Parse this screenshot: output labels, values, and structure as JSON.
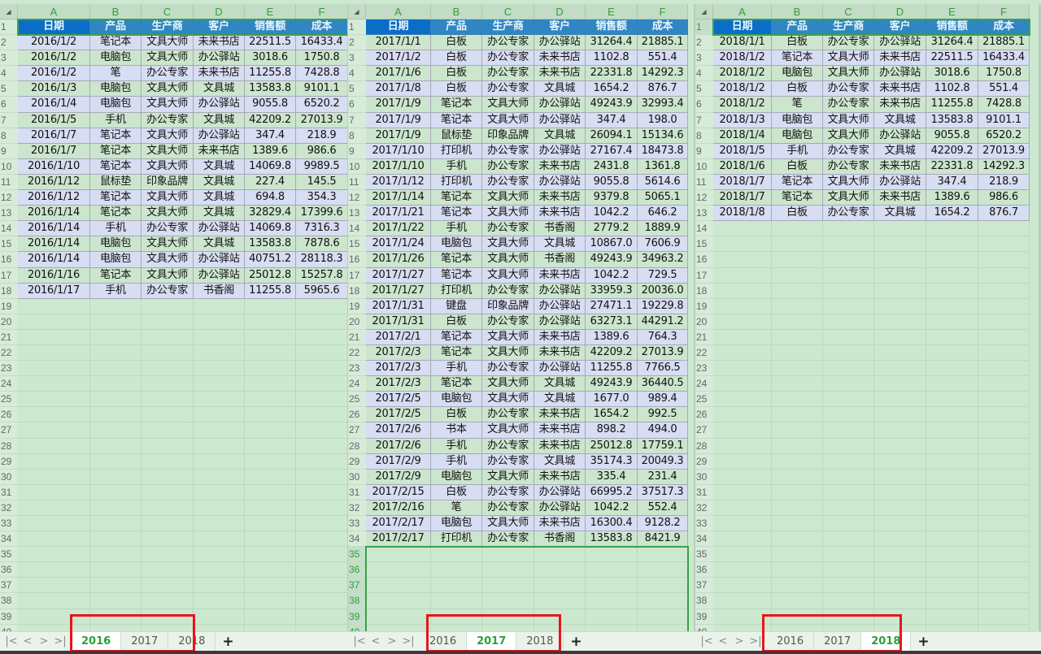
{
  "columns": [
    "A",
    "B",
    "C",
    "D",
    "E",
    "F"
  ],
  "header_row": [
    "日期",
    "产品",
    "生产商",
    "客户",
    "销售额",
    "成本"
  ],
  "tab_nav": {
    "first": "|<",
    "prev": "<",
    "next": ">",
    "last": ">|"
  },
  "add_sheet_label": "+",
  "highlight_color": "#e5161d",
  "accent_color": "#2e9e3e",
  "header_fill": "#2f86c2",
  "panes": [
    {
      "id": "2016",
      "active_tab": "2016",
      "tabs": [
        "2016",
        "2017",
        "2018"
      ],
      "visible_row_count": 40,
      "rows": [
        [
          "2016/1/2",
          "笔记本",
          "文具大师",
          "未来书店",
          "22511.5",
          "16433.4"
        ],
        [
          "2016/1/2",
          "电脑包",
          "文具大师",
          "办公驿站",
          "3018.6",
          "1750.8"
        ],
        [
          "2016/1/2",
          "笔",
          "办公专家",
          "未来书店",
          "11255.8",
          "7428.8"
        ],
        [
          "2016/1/3",
          "电脑包",
          "文具大师",
          "文具城",
          "13583.8",
          "9101.1"
        ],
        [
          "2016/1/4",
          "电脑包",
          "文具大师",
          "办公驿站",
          "9055.8",
          "6520.2"
        ],
        [
          "2016/1/5",
          "手机",
          "办公专家",
          "文具城",
          "42209.2",
          "27013.9"
        ],
        [
          "2016/1/7",
          "笔记本",
          "文具大师",
          "办公驿站",
          "347.4",
          "218.9"
        ],
        [
          "2016/1/7",
          "笔记本",
          "文具大师",
          "未来书店",
          "1389.6",
          "986.6"
        ],
        [
          "2016/1/10",
          "笔记本",
          "文具大师",
          "文具城",
          "14069.8",
          "9989.5"
        ],
        [
          "2016/1/12",
          "鼠标垫",
          "印象品牌",
          "文具城",
          "227.4",
          "145.5"
        ],
        [
          "2016/1/12",
          "笔记本",
          "文具大师",
          "文具城",
          "694.8",
          "354.3"
        ],
        [
          "2016/1/14",
          "笔记本",
          "文具大师",
          "文具城",
          "32829.4",
          "17399.6"
        ],
        [
          "2016/1/14",
          "手机",
          "办公专家",
          "办公驿站",
          "14069.8",
          "7316.3"
        ],
        [
          "2016/1/14",
          "电脑包",
          "文具大师",
          "文具城",
          "13583.8",
          "7878.6"
        ],
        [
          "2016/1/14",
          "电脑包",
          "文具大师",
          "办公驿站",
          "40751.2",
          "28118.3"
        ],
        [
          "2016/1/16",
          "笔记本",
          "文具大师",
          "办公驿站",
          "25012.8",
          "15257.8"
        ],
        [
          "2016/1/17",
          "手机",
          "办公专家",
          "书香阁",
          "11255.8",
          "5965.6"
        ]
      ]
    },
    {
      "id": "2017",
      "active_tab": "2017",
      "tabs": [
        "2016",
        "2017",
        "2018"
      ],
      "visible_row_count": 40,
      "rows": [
        [
          "2017/1/1",
          "白板",
          "办公专家",
          "办公驿站",
          "31264.4",
          "21885.1"
        ],
        [
          "2017/1/2",
          "白板",
          "办公专家",
          "未来书店",
          "1102.8",
          "551.4"
        ],
        [
          "2017/1/6",
          "白板",
          "办公专家",
          "未来书店",
          "22331.8",
          "14292.3"
        ],
        [
          "2017/1/8",
          "白板",
          "办公专家",
          "文具城",
          "1654.2",
          "876.7"
        ],
        [
          "2017/1/9",
          "笔记本",
          "文具大师",
          "办公驿站",
          "49243.9",
          "32993.4"
        ],
        [
          "2017/1/9",
          "笔记本",
          "文具大师",
          "办公驿站",
          "347.4",
          "198.0"
        ],
        [
          "2017/1/9",
          "鼠标垫",
          "印象品牌",
          "文具城",
          "26094.1",
          "15134.6"
        ],
        [
          "2017/1/10",
          "打印机",
          "办公专家",
          "办公驿站",
          "27167.4",
          "18473.8"
        ],
        [
          "2017/1/10",
          "手机",
          "办公专家",
          "未来书店",
          "2431.8",
          "1361.8"
        ],
        [
          "2017/1/12",
          "打印机",
          "办公专家",
          "办公驿站",
          "9055.8",
          "5614.6"
        ],
        [
          "2017/1/14",
          "笔记本",
          "文具大师",
          "未来书店",
          "9379.8",
          "5065.1"
        ],
        [
          "2017/1/21",
          "笔记本",
          "文具大师",
          "未来书店",
          "1042.2",
          "646.2"
        ],
        [
          "2017/1/22",
          "手机",
          "办公专家",
          "书香阁",
          "2779.2",
          "1889.9"
        ],
        [
          "2017/1/24",
          "电脑包",
          "文具大师",
          "文具城",
          "10867.0",
          "7606.9"
        ],
        [
          "2017/1/26",
          "笔记本",
          "文具大师",
          "书香阁",
          "49243.9",
          "34963.2"
        ],
        [
          "2017/1/27",
          "笔记本",
          "文具大师",
          "未来书店",
          "1042.2",
          "729.5"
        ],
        [
          "2017/1/27",
          "打印机",
          "办公专家",
          "办公驿站",
          "33959.3",
          "20036.0"
        ],
        [
          "2017/1/31",
          "键盘",
          "印象品牌",
          "办公驿站",
          "27471.1",
          "19229.8"
        ],
        [
          "2017/1/31",
          "白板",
          "办公专家",
          "办公驿站",
          "63273.1",
          "44291.2"
        ],
        [
          "2017/2/1",
          "笔记本",
          "文具大师",
          "未来书店",
          "1389.6",
          "764.3"
        ],
        [
          "2017/2/3",
          "笔记本",
          "文具大师",
          "未来书店",
          "42209.2",
          "27013.9"
        ],
        [
          "2017/2/3",
          "手机",
          "办公专家",
          "办公驿站",
          "11255.8",
          "7766.5"
        ],
        [
          "2017/2/3",
          "笔记本",
          "文具大师",
          "文具城",
          "49243.9",
          "36440.5"
        ],
        [
          "2017/2/5",
          "电脑包",
          "文具大师",
          "文具城",
          "1677.0",
          "989.4"
        ],
        [
          "2017/2/5",
          "白板",
          "办公专家",
          "未来书店",
          "1654.2",
          "992.5"
        ],
        [
          "2017/2/6",
          "书本",
          "文具大师",
          "未来书店",
          "898.2",
          "494.0"
        ],
        [
          "2017/2/6",
          "手机",
          "办公专家",
          "未来书店",
          "25012.8",
          "17759.1"
        ],
        [
          "2017/2/9",
          "手机",
          "办公专家",
          "文具城",
          "35174.3",
          "20049.3"
        ],
        [
          "2017/2/9",
          "电脑包",
          "文具大师",
          "未来书店",
          "335.4",
          "231.4"
        ],
        [
          "2017/2/15",
          "白板",
          "办公专家",
          "办公驿站",
          "66995.2",
          "37517.3"
        ],
        [
          "2017/2/16",
          "笔",
          "办公专家",
          "办公驿站",
          "1042.2",
          "552.4"
        ],
        [
          "2017/2/17",
          "电脑包",
          "文具大师",
          "未来书店",
          "16300.4",
          "9128.2"
        ],
        [
          "2017/2/17",
          "打印机",
          "办公专家",
          "书香阁",
          "13583.8",
          "8421.9"
        ]
      ]
    },
    {
      "id": "2018",
      "active_tab": "2018",
      "tabs": [
        "2016",
        "2017",
        "2018"
      ],
      "visible_row_count": 40,
      "rows": [
        [
          "2018/1/1",
          "白板",
          "办公专家",
          "办公驿站",
          "31264.4",
          "21885.1"
        ],
        [
          "2018/1/2",
          "笔记本",
          "文具大师",
          "未来书店",
          "22511.5",
          "16433.4"
        ],
        [
          "2018/1/2",
          "电脑包",
          "文具大师",
          "办公驿站",
          "3018.6",
          "1750.8"
        ],
        [
          "2018/1/2",
          "白板",
          "办公专家",
          "未来书店",
          "1102.8",
          "551.4"
        ],
        [
          "2018/1/2",
          "笔",
          "办公专家",
          "未来书店",
          "11255.8",
          "7428.8"
        ],
        [
          "2018/1/3",
          "电脑包",
          "文具大师",
          "文具城",
          "13583.8",
          "9101.1"
        ],
        [
          "2018/1/4",
          "电脑包",
          "文具大师",
          "办公驿站",
          "9055.8",
          "6520.2"
        ],
        [
          "2018/1/5",
          "手机",
          "办公专家",
          "文具城",
          "42209.2",
          "27013.9"
        ],
        [
          "2018/1/6",
          "白板",
          "办公专家",
          "未来书店",
          "22331.8",
          "14292.3"
        ],
        [
          "2018/1/7",
          "笔记本",
          "文具大师",
          "办公驿站",
          "347.4",
          "218.9"
        ],
        [
          "2018/1/7",
          "笔记本",
          "文具大师",
          "未来书店",
          "1389.6",
          "986.6"
        ],
        [
          "2018/1/8",
          "白板",
          "办公专家",
          "文具城",
          "1654.2",
          "876.7"
        ]
      ]
    }
  ]
}
